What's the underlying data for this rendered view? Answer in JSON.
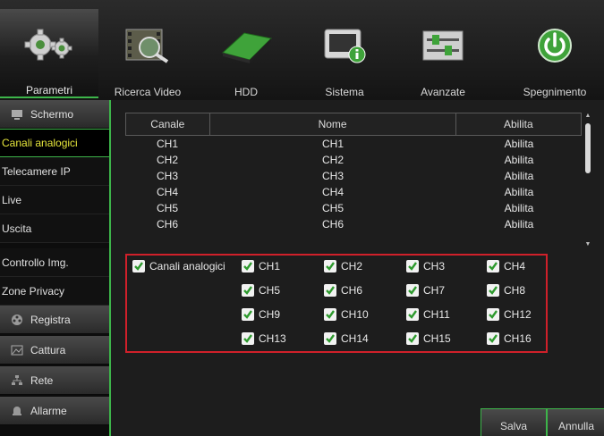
{
  "tabs": [
    {
      "label": "Parametri",
      "icon": "gears-icon",
      "active": true
    },
    {
      "label": "Ricerca Video",
      "icon": "film-search-icon",
      "active": false
    },
    {
      "label": "HDD",
      "icon": "hdd-icon",
      "active": false
    },
    {
      "label": "Sistema",
      "icon": "system-info-icon",
      "active": false
    },
    {
      "label": "Avanzate",
      "icon": "sliders-icon",
      "active": false
    },
    {
      "label": "Spegnimento",
      "icon": "power-icon",
      "active": false
    }
  ],
  "sidebar": {
    "schermo": "Schermo",
    "canali_analogici": "Canali analogici",
    "telecamere_ip": "Telecamere IP",
    "live": "Live",
    "uscita": "Uscita",
    "controllo_img": "Controllo Img.",
    "zone_privacy": "Zone Privacy",
    "registra": "Registra",
    "cattura": "Cattura",
    "rete": "Rete",
    "allarme": "Allarme"
  },
  "table": {
    "headers": [
      "Canale",
      "Nome",
      "Abilita"
    ],
    "rows": [
      [
        "CH1",
        "CH1",
        "Abilita"
      ],
      [
        "CH2",
        "CH2",
        "Abilita"
      ],
      [
        "CH3",
        "CH3",
        "Abilita"
      ],
      [
        "CH4",
        "CH4",
        "Abilita"
      ],
      [
        "CH5",
        "CH5",
        "Abilita"
      ],
      [
        "CH6",
        "CH6",
        "Abilita"
      ]
    ]
  },
  "checks": {
    "all_label": "Canali analogici",
    "channels": [
      "CH1",
      "CH2",
      "CH3",
      "CH4",
      "CH5",
      "CH6",
      "CH7",
      "CH8",
      "CH9",
      "CH10",
      "CH11",
      "CH12",
      "CH13",
      "CH14",
      "CH15",
      "CH16"
    ]
  },
  "buttons": {
    "save": "Salva",
    "cancel": "Annulla"
  },
  "colors": {
    "accent": "#3db54a",
    "highlight": "#e6e63c",
    "alert_border": "#d0202a"
  }
}
